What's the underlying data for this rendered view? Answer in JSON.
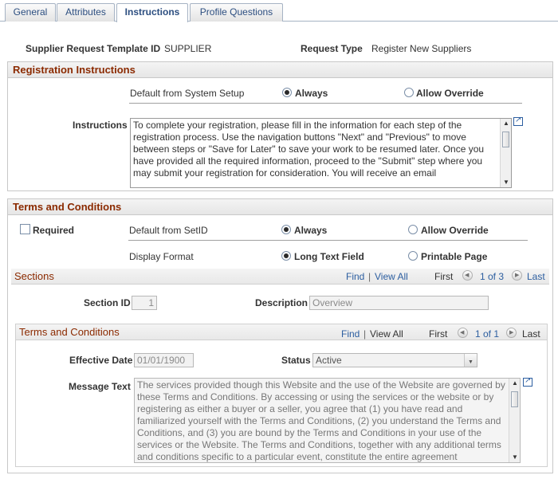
{
  "tabs": [
    {
      "label": "General"
    },
    {
      "label": "Attributes"
    },
    {
      "label": "Instructions"
    },
    {
      "label": "Profile Questions"
    }
  ],
  "header": {
    "template_id_label": "Supplier Request Template ID",
    "template_id_value": "SUPPLIER",
    "request_type_label": "Request Type",
    "request_type_value": "Register New Suppliers"
  },
  "registration": {
    "title": "Registration Instructions",
    "default_label": "Default from System Setup",
    "always_label": "Always",
    "override_label": "Allow Override",
    "instructions_label": "Instructions",
    "instructions_text": "To complete your registration, please fill in the information for each step of the registration process.  Use the navigation buttons \"Next\" and \"Previous\" to move between steps or \"Save for Later\" to save your work to be resumed later.  Once you have provided all the required information, proceed to the \"Submit\" step where you may submit your registration for consideration.  You will receive an email"
  },
  "terms": {
    "title": "Terms and Conditions",
    "required_label": "Required",
    "default_label": "Default from SetID",
    "always_label": "Always",
    "override_label": "Allow Override",
    "display_format_label": "Display Format",
    "long_text_label": "Long Text Field",
    "printable_label": "Printable Page",
    "sections": {
      "title": "Sections",
      "find": "Find",
      "sep": "|",
      "view_all": "View All",
      "first": "First",
      "range": "1 of 3",
      "last": "Last",
      "section_id_label": "Section ID",
      "section_id_value": "1",
      "description_label": "Description",
      "description_value": "Overview"
    },
    "inner": {
      "title": "Terms and Conditions",
      "find": "Find",
      "sep": "|",
      "view_all": "View All",
      "first": "First",
      "range": "1 of 1",
      "last": "Last",
      "effective_date_label": "Effective Date",
      "effective_date_value": "01/01/1900",
      "status_label": "Status",
      "status_value": "Active",
      "message_label": "Message Text",
      "message_text": "The services provided though this Website and the use of the Website are governed by these Terms and Conditions.  By accessing or using the services or the website or by registering as either a buyer or a seller, you agree that (1) you have read and familiarized yourself with the Terms and Conditions, (2) you understand the Terms and Conditions, and (3) you are bound by the Terms and Conditions in your use of the services or the Website.  The Terms and Conditions, together with any additional terms and conditions specific to a particular event, constitute the entire agreement"
    }
  }
}
